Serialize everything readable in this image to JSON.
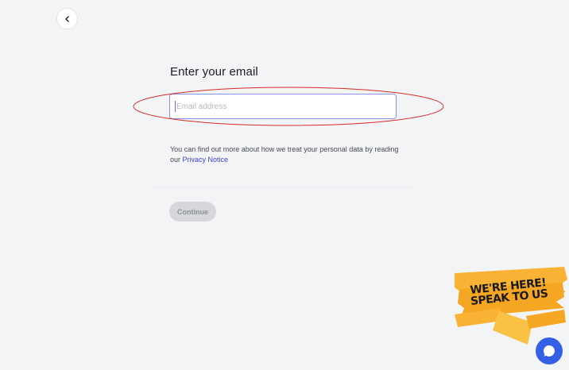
{
  "nav": {
    "back_icon": "chevron-left-icon"
  },
  "form": {
    "heading": "Enter your email",
    "email_placeholder": "Email address",
    "email_value": "",
    "privacy_text": "You can find out more about how we treat your personal data by reading our ",
    "privacy_link": "Privacy Notice",
    "continue_label": "Continue"
  },
  "promo": {
    "line1": "WE'RE HERE!",
    "line2": "SPEAK TO US"
  },
  "chat": {
    "icon": "chat-bubble-icon"
  },
  "colors": {
    "background": "#f3f4f6",
    "accent": "#3d46d6",
    "annotation": "#d62828",
    "promo_yellow": "#f9b233",
    "chat_blue": "#3460e6"
  }
}
